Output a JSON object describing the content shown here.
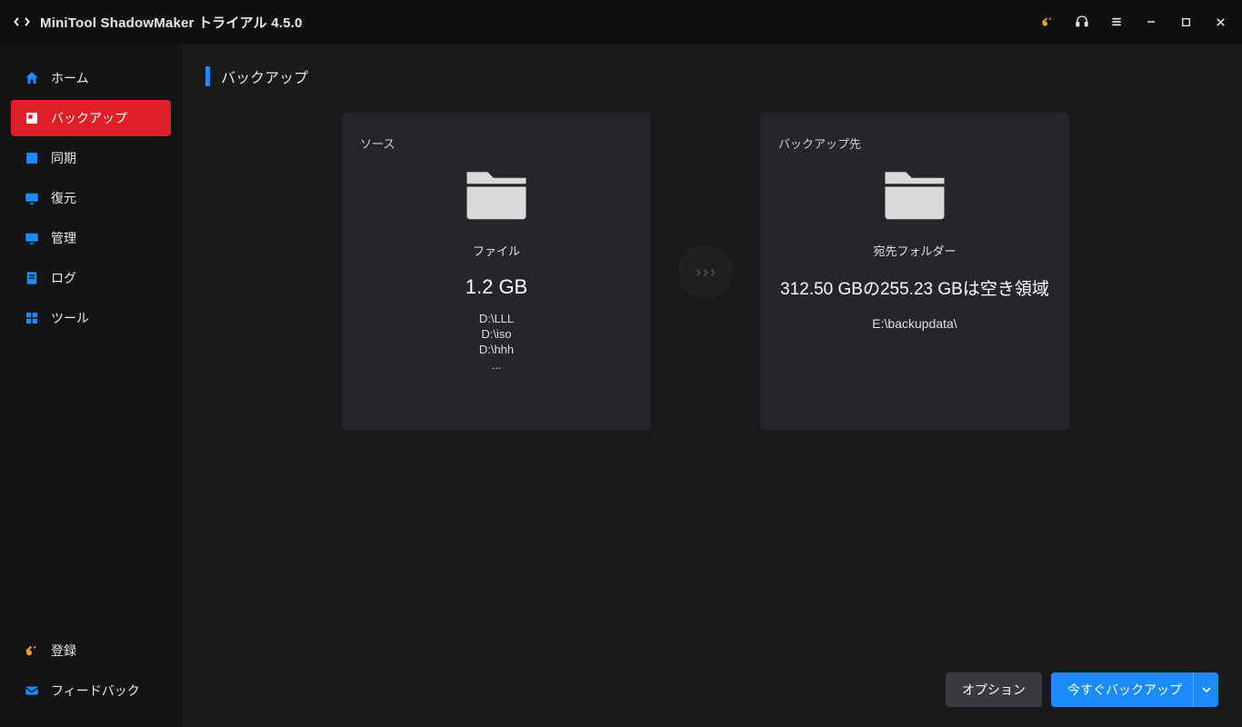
{
  "titlebar": {
    "app_name": "MiniTool ShadowMaker",
    "edition": "トライアル",
    "version": "4.5.0"
  },
  "sidebar": {
    "items": [
      {
        "label": "ホーム"
      },
      {
        "label": "バックアップ"
      },
      {
        "label": "同期"
      },
      {
        "label": "復元"
      },
      {
        "label": "管理"
      },
      {
        "label": "ログ"
      },
      {
        "label": "ツール"
      }
    ],
    "register_label": "登録",
    "feedback_label": "フィードバック"
  },
  "page": {
    "title": "バックアップ",
    "source": {
      "card_label": "ソース",
      "type_label": "ファイル",
      "size": "1.2 GB",
      "paths": [
        "D:\\LLL",
        "D:\\iso",
        "D:\\hhh"
      ],
      "more": "..."
    },
    "destination": {
      "card_label": "バックアップ先",
      "type_label": "宛先フォルダー",
      "free_text": "312.50 GBの255.23 GBは空き領域",
      "path": "E:\\backupdata\\"
    },
    "buttons": {
      "options": "オプション",
      "backup_now": "今すぐバックアップ"
    }
  }
}
